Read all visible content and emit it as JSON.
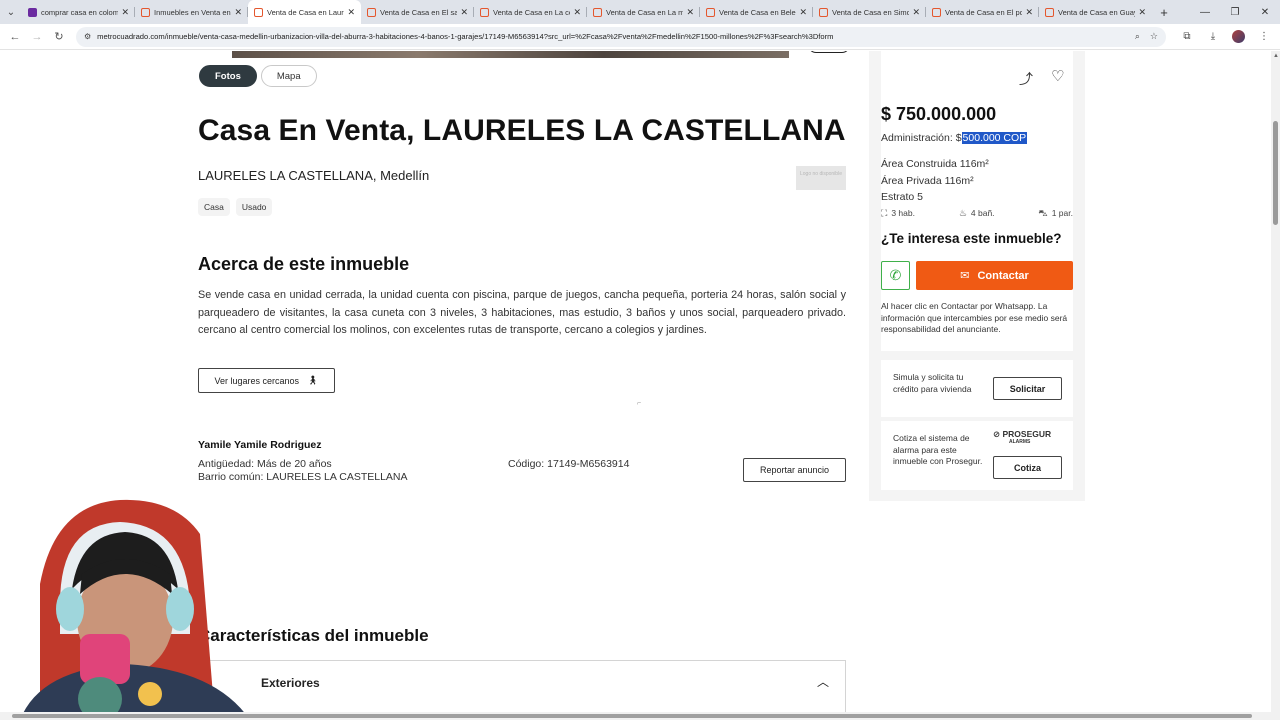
{
  "browser": {
    "tabs": [
      {
        "title": "comprar casa en colom",
        "favicon": "yahoo-purple"
      },
      {
        "title": "Inmuebles en Venta en",
        "favicon": "metrocuadrado"
      },
      {
        "title": "Venta de Casa en Laure",
        "favicon": "metrocuadrado",
        "active": true
      },
      {
        "title": "Venta de Casa en El sal",
        "favicon": "metrocuadrado"
      },
      {
        "title": "Venta de Casa en La co",
        "favicon": "metrocuadrado"
      },
      {
        "title": "Venta de Casa en La m",
        "favicon": "metrocuadrado"
      },
      {
        "title": "Venta de Casa en Belen",
        "favicon": "metrocuadrado"
      },
      {
        "title": "Venta de Casa en Simo",
        "favicon": "metrocuadrado"
      },
      {
        "title": "Venta de Casa en El po",
        "favicon": "metrocuadrado"
      },
      {
        "title": "Venta de Casa en Guay",
        "favicon": "metrocuadrado"
      }
    ],
    "url": "metrocuadrado.com/inmueble/venta-casa-medellin-urbanizacion-villa-del-aburra-3-habitaciones-4-banos-1-garajes/17149-M6563914?src_url=%2Fcasa%2Fventa%2Fmedellin%2F1500-millones%2F%3Fsearch%3Dform"
  },
  "media_tabs": {
    "photos": "Fotos",
    "map": "Mapa"
  },
  "listing": {
    "title": "Casa En Venta, LAURELES LA CASTELLANA",
    "location": "LAURELES LA CASTELLANA, Medellín",
    "logo_placeholder": "Logo no disponible",
    "tags": [
      "Casa",
      "Usado"
    ],
    "about_heading": "Acerca de este inmueble",
    "description": "Se vende casa en unidad cerrada, la unidad cuenta con piscina, parque de juegos, cancha pequeña, porteria 24 horas, salón social y parqueadero de visitantes, la casa cuneta con 3 niveles, 3 habitaciones, mas estudio, 3 baños y unos social, parqueadero privado. cercano al centro comercial los molinos, con excelentes rutas de transporte, cercano a colegios y jardines.",
    "nearby_button": "Ver lugares cercanos",
    "agent_name": "Yamile Yamile Rodriguez",
    "antiguedad": "Antigüedad: Más de 20 años",
    "barrio": "Barrio común: LAURELES LA CASTELLANA",
    "codigo": "Código: 17149-M6563914",
    "report_button": "Reportar anuncio",
    "features_heading": "Características del inmueble",
    "features_section_label": "Exteriores"
  },
  "sidebar": {
    "price": "$ 750.000.000",
    "admin_label": "Administración: $",
    "admin_value": "500.000 COP",
    "area_construida": "Área Construida 116m²",
    "area_privada": "Área Privada 116m²",
    "estrato": "Estrato 5",
    "rooms": "3 hab.",
    "baths": "4 bañ.",
    "parking": "1 par.",
    "interest_heading": "¿Te interesa este inmueble?",
    "contact_button": "Contactar",
    "disclaimer": "Al hacer clic en Contactar por Whatsapp. La información que intercambies por ese medio será responsabilidad del anunciante.",
    "credit_text": "Simula y solicita tu crédito para vivienda",
    "credit_button": "Solicitar",
    "alarm_text": "Cotiza el sistema de alarma para este inmueble con Prosegur.",
    "alarm_button": "Cotiza",
    "prosegur_logo": "PROSEGUR",
    "prosegur_sub": "ALARMS"
  },
  "colors": {
    "accent": "#f05a14",
    "whatsapp": "#2da53a",
    "selection": "#2058c8"
  }
}
